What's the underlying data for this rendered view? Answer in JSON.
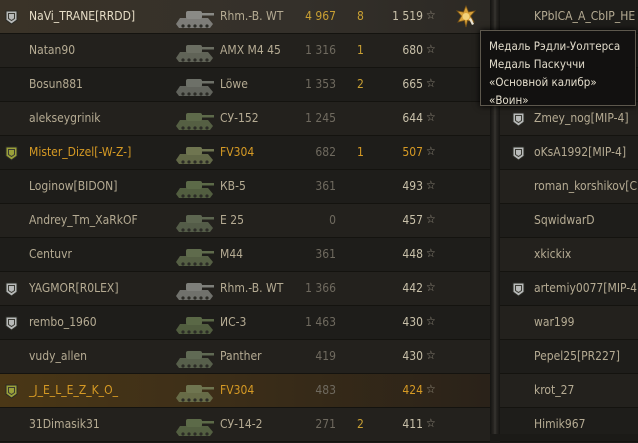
{
  "left_rows": [
    {
      "name": "NaVi_TRANE[RRDD]",
      "vehicle": "Rhm.-B. WT",
      "damage": "4 967",
      "kills": "8",
      "xp": "1 519",
      "badge": "silver",
      "style": "self",
      "medal": true,
      "tank_color": "#8a8a86"
    },
    {
      "name": "Natan90",
      "vehicle": "AMX M4 45",
      "damage": "1 316",
      "kills": "1",
      "xp": "680",
      "badge": "",
      "style": "alt",
      "tank_color": "#6b6e62"
    },
    {
      "name": "Bosun881",
      "vehicle": "Löwe",
      "damage": "1 353",
      "kills": "2",
      "xp": "665",
      "badge": "",
      "style": "",
      "tank_color": "#6d7068"
    },
    {
      "name": "alekseygrinik",
      "vehicle": "СУ-152",
      "damage": "1 245",
      "kills": "",
      "xp": "644",
      "badge": "",
      "style": "alt",
      "tank_color": "#5e6a4a"
    },
    {
      "name": "Mister_Dizel[-W-Z-]",
      "vehicle": "FV304",
      "damage": "682",
      "kills": "1",
      "xp": "507",
      "badge": "gold",
      "style": "orange",
      "tank_color": "#6f7550"
    },
    {
      "name": "Loginow[BIDON]",
      "vehicle": "КВ-5",
      "damage": "361",
      "kills": "",
      "xp": "493",
      "badge": "",
      "style": "",
      "tank_color": "#5c6a48"
    },
    {
      "name": "Andrey_Tm_XaRkOF",
      "vehicle": "E 25",
      "damage": "0",
      "kills": "",
      "xp": "457",
      "badge": "",
      "style": "alt",
      "tank_color": "#5d6650"
    },
    {
      "name": "Centuvr",
      "vehicle": "M44",
      "damage": "361",
      "kills": "",
      "xp": "448",
      "badge": "",
      "style": "",
      "tank_color": "#5f6b4c"
    },
    {
      "name": "YAGMOR[R0LEX]",
      "vehicle": "Rhm.-B. WT",
      "damage": "1 366",
      "kills": "",
      "xp": "442",
      "badge": "silver",
      "style": "alt",
      "tank_color": "#7e7f7a"
    },
    {
      "name": "rembo_1960",
      "vehicle": "ИС-3",
      "damage": "1 463",
      "kills": "",
      "xp": "430",
      "badge": "silver",
      "style": "",
      "tank_color": "#5a6846"
    },
    {
      "name": "vudy_allen",
      "vehicle": "Panther",
      "damage": "419",
      "kills": "",
      "xp": "430",
      "badge": "",
      "style": "alt",
      "tank_color": "#606a54"
    },
    {
      "name": "_J_E_L_E_Z_K_O_",
      "vehicle": "FV304",
      "damage": "483",
      "kills": "",
      "xp": "424",
      "badge": "gold",
      "style": "platoon orange",
      "tank_color": "#6f7550"
    },
    {
      "name": "31Dimasik31",
      "vehicle": "СУ-14-2",
      "damage": "271",
      "kills": "2",
      "xp": "411",
      "badge": "",
      "style": "alt",
      "tank_color": "#5c6a48"
    }
  ],
  "right_rows": [
    {
      "name": "KPbICA_A_CbIP_HE",
      "badge": ""
    },
    {
      "name": "",
      "badge": ""
    },
    {
      "name": "",
      "badge": ""
    },
    {
      "name": "Zmey_nog[MIP-4]",
      "badge": "silver"
    },
    {
      "name": "oKsA1992[MIP-4]",
      "badge": "silver"
    },
    {
      "name": "roman_korshikov[C",
      "badge": ""
    },
    {
      "name": "SqwidwarD",
      "badge": ""
    },
    {
      "name": "xkickix",
      "badge": ""
    },
    {
      "name": "artemiy0077[MIP-4",
      "badge": "silver"
    },
    {
      "name": "war199",
      "badge": ""
    },
    {
      "name": "Pepel25[PR227]",
      "badge": ""
    },
    {
      "name": "krot_27",
      "badge": ""
    },
    {
      "name": "Himik967",
      "badge": ""
    }
  ],
  "tooltip": {
    "lines": [
      "Медаль Рэдли-Уолтерса",
      "Медаль Паскуччи",
      "«Основной калибр»",
      "«Воин»"
    ]
  },
  "icons": {
    "star": "☆",
    "badge": "clan-badge-icon",
    "tank": "tank-icon",
    "medal": "medal-icon"
  },
  "colors": {
    "gold_badge": "#9aa03a",
    "silver_badge": "#b7b9b8",
    "orange_text": "#d69a24",
    "self_damage": "#c9a033"
  }
}
